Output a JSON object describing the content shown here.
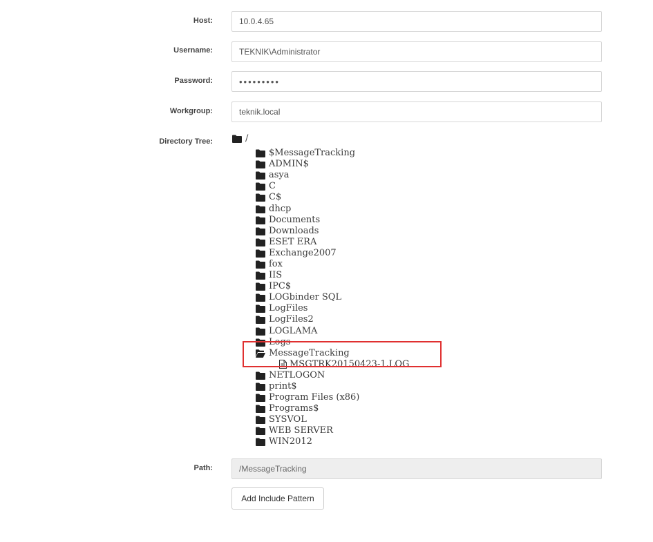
{
  "form": {
    "host": {
      "label": "Host:",
      "value": "10.0.4.65"
    },
    "username": {
      "label": "Username:",
      "value": "TEKNIK\\Administrator"
    },
    "password": {
      "label": "Password:",
      "value": "•••••••••"
    },
    "workgroup": {
      "label": "Workgroup:",
      "value": "teknik.local"
    },
    "directory_tree": {
      "label": "Directory Tree:"
    },
    "path": {
      "label": "Path:",
      "value": "/MessageTracking"
    }
  },
  "tree": {
    "root": "/",
    "folders": [
      "$MessageTracking",
      "ADMIN$",
      "asya",
      "C",
      "C$",
      "dhcp",
      "Documents",
      "Downloads",
      "ESET ERA",
      "Exchange2007",
      "fox",
      "IIS",
      "IPC$",
      "LOGbinder SQL",
      "LogFiles",
      "LogFiles2",
      "LOGLAMA",
      "Logs",
      "MessageTracking",
      "NETLOGON",
      "print$",
      "Program Files (x86)",
      "Programs$",
      "SYSVOL",
      "WEB SERVER",
      "WIN2012"
    ],
    "expanded_folder": "MessageTracking",
    "expanded_files": [
      "MSGTRK20150423-1.LOG"
    ]
  },
  "buttons": {
    "add_include_pattern": "Add Include Pattern"
  },
  "colors": {
    "highlight": "#e03030",
    "readonly_bg": "#eeeeee",
    "border": "#d6d6d6"
  },
  "icons": {
    "folder": "folder-icon",
    "folder_open": "folder-open-icon",
    "file": "file-icon"
  }
}
